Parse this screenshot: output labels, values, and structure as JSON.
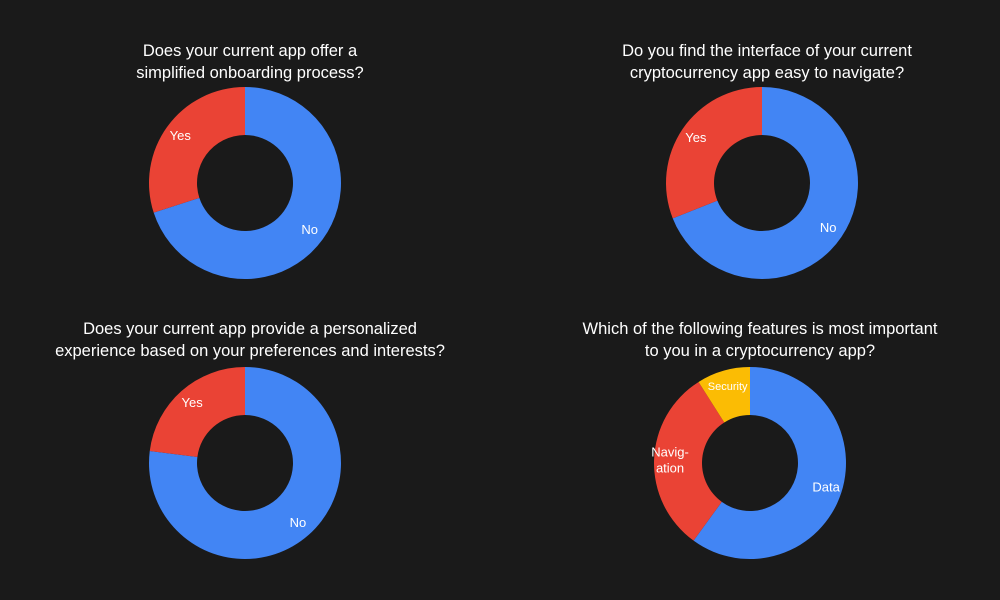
{
  "colors": {
    "background": "#1a1a1a",
    "blue": "#4285f4",
    "red": "#ea4335",
    "yellow": "#fbbc04",
    "text": "#ffffff"
  },
  "chart_data": [
    {
      "type": "pie",
      "title_lines": [
        "Does your current app offer a",
        "simplified onboarding process?"
      ],
      "slices": [
        {
          "label": "No",
          "value": 70,
          "color": "#4285f4"
        },
        {
          "label": "Yes",
          "value": 30,
          "color": "#ea4335"
        }
      ]
    },
    {
      "type": "pie",
      "title_lines": [
        "Do you find the interface of your current",
        "cryptocurrency app easy to navigate?"
      ],
      "slices": [
        {
          "label": "No",
          "value": 69,
          "color": "#4285f4"
        },
        {
          "label": "Yes",
          "value": 31,
          "color": "#ea4335"
        }
      ]
    },
    {
      "type": "pie",
      "title_lines": [
        "Does your current app provide a personalized",
        "experience based on your preferences and interests?"
      ],
      "slices": [
        {
          "label": "No",
          "value": 77,
          "color": "#4285f4"
        },
        {
          "label": "Yes",
          "value": 23,
          "color": "#ea4335"
        }
      ]
    },
    {
      "type": "pie",
      "title_lines": [
        "Which of the following features is most important",
        "to you in a  cryptocurrency app?"
      ],
      "slices": [
        {
          "label": "Data",
          "value": 60,
          "color": "#4285f4"
        },
        {
          "label": "Navig-\nation",
          "value": 31,
          "color": "#ea4335"
        },
        {
          "label": "Security",
          "value": 9,
          "color": "#fbbc04"
        }
      ]
    }
  ]
}
